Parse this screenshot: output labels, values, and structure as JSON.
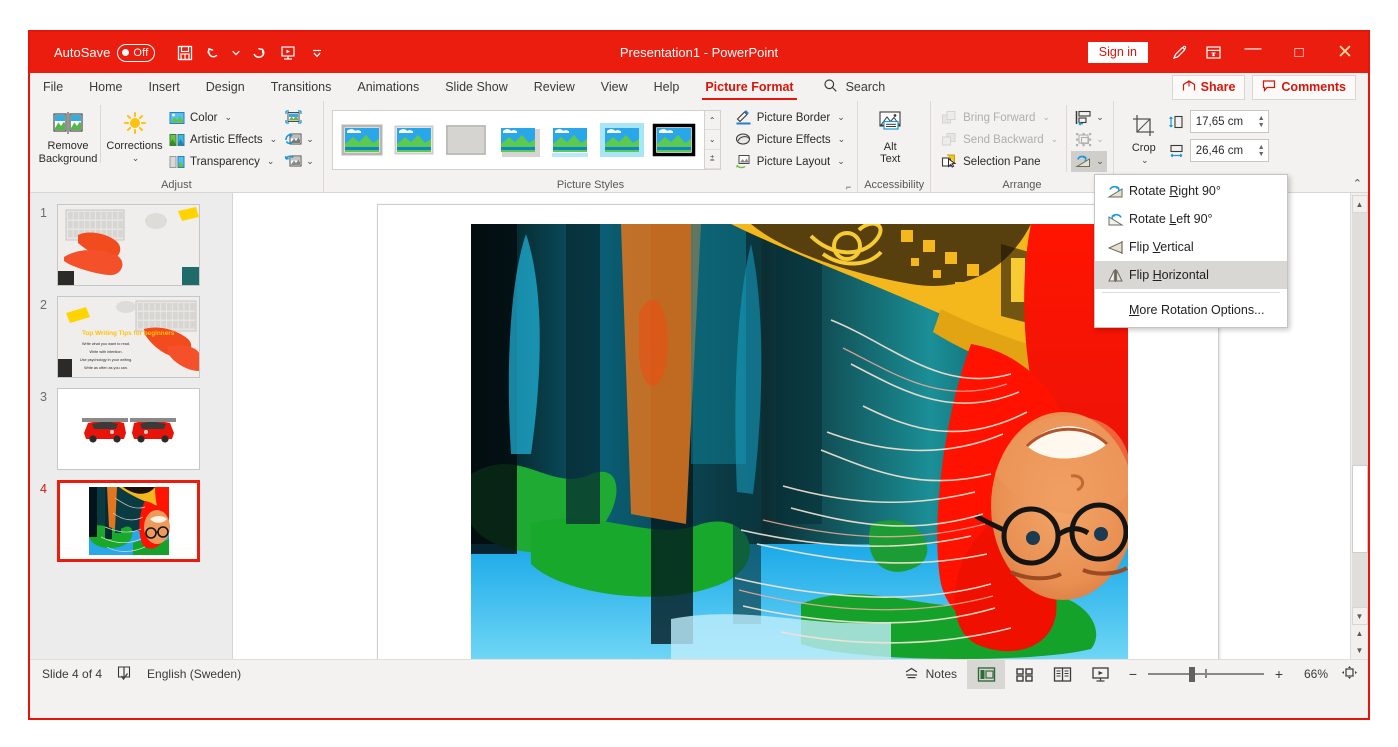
{
  "titlebar": {
    "autosave_label": "AutoSave",
    "autosave_state": "Off",
    "document_title": "Presentation1  -  PowerPoint",
    "signin_label": "Sign in",
    "qat": [
      {
        "name": "save-icon",
        "label": "Save"
      },
      {
        "name": "undo-icon",
        "label": "Undo"
      },
      {
        "name": "redo-icon",
        "label": "Redo"
      },
      {
        "name": "start-presentation-icon",
        "label": "Start From Beginning"
      },
      {
        "name": "customize-qat-icon",
        "label": "Customize Quick Access Toolbar"
      }
    ],
    "window_buttons": {
      "minimize": "—",
      "maximize": "□",
      "close": "✕"
    },
    "pen_icon": "draw-pen-icon",
    "ribbon_display_icon": "ribbon-display-options-icon"
  },
  "tabs": [
    {
      "label": "File",
      "active": false
    },
    {
      "label": "Home",
      "active": false
    },
    {
      "label": "Insert",
      "active": false
    },
    {
      "label": "Design",
      "active": false
    },
    {
      "label": "Transitions",
      "active": false
    },
    {
      "label": "Animations",
      "active": false
    },
    {
      "label": "Slide Show",
      "active": false
    },
    {
      "label": "Review",
      "active": false
    },
    {
      "label": "View",
      "active": false
    },
    {
      "label": "Help",
      "active": false
    },
    {
      "label": "Picture Format",
      "active": true
    }
  ],
  "search": {
    "label": "Search",
    "icon": "search-icon"
  },
  "tabstrip_right": {
    "share_label": "Share",
    "comments_label": "Comments"
  },
  "ribbon": {
    "groups": [
      {
        "name": "adjust",
        "label": "Adjust",
        "remove_background": "Remove\nBackground",
        "remove_background_line1": "Remove",
        "remove_background_line2": "Background",
        "corrections": "Corrections",
        "items": [
          {
            "label": "Color",
            "caret": true,
            "icon": "color-picture-icon"
          },
          {
            "label": "Artistic Effects",
            "caret": true,
            "icon": "artistic-effects-icon"
          },
          {
            "label": "Transparency",
            "caret": true,
            "icon": "transparency-icon"
          }
        ],
        "icon_only": [
          {
            "icon": "compress-pictures-icon",
            "caret": false
          },
          {
            "icon": "change-picture-icon",
            "caret": true
          },
          {
            "icon": "reset-picture-icon",
            "caret": true
          }
        ]
      },
      {
        "name": "picture-styles",
        "label": "Picture Styles",
        "style_count": 7,
        "selected_style_index": 6,
        "scroll_up": "⌃",
        "scroll_down": "⌄",
        "more": "⩲"
      },
      {
        "name": "picture-styles-right",
        "items": [
          {
            "label": "Picture Border",
            "caret": true,
            "icon": "picture-border-icon"
          },
          {
            "label": "Picture Effects",
            "caret": true,
            "icon": "picture-effects-icon"
          },
          {
            "label": "Picture Layout",
            "caret": true,
            "icon": "picture-layout-icon"
          }
        ]
      },
      {
        "name": "accessibility",
        "label": "Accessibility",
        "alt_text_line1": "Alt",
        "alt_text_line2": "Text"
      },
      {
        "name": "arrange",
        "label": "Arrange",
        "items": [
          {
            "label": "Bring Forward",
            "caret": true,
            "disabled": true,
            "icon": "bring-forward-icon"
          },
          {
            "label": "Send Backward",
            "caret": true,
            "disabled": true,
            "icon": "send-backward-icon"
          },
          {
            "label": "Selection Pane",
            "caret": false,
            "disabled": false,
            "icon": "selection-pane-icon"
          }
        ],
        "icon_only": [
          {
            "icon": "align-objects-icon",
            "caret": true,
            "disabled": false
          },
          {
            "icon": "group-objects-icon",
            "caret": true,
            "disabled": true
          },
          {
            "icon": "rotate-objects-icon",
            "caret": true,
            "disabled": false,
            "active": true
          }
        ]
      },
      {
        "name": "size",
        "label": "",
        "crop_label": "Crop",
        "height_value": "17,65 cm",
        "width_value": "26,46 cm",
        "height_icon": "shape-height-icon",
        "width_icon": "shape-width-icon"
      }
    ],
    "collapse_icon": "collapse-ribbon-icon"
  },
  "rotate_menu": {
    "items": [
      {
        "id": "rotate-right-90",
        "pre": "Rotate ",
        "accel": "R",
        "post": "ight 90°",
        "icon": "rotate-right-icon",
        "selected": false
      },
      {
        "id": "rotate-left-90",
        "pre": "Rotate ",
        "accel": "L",
        "post": "eft 90°",
        "icon": "rotate-left-icon",
        "selected": false
      },
      {
        "id": "flip-vertical",
        "pre": "Flip ",
        "accel": "V",
        "post": "ertical",
        "icon": "flip-vertical-icon",
        "selected": false
      },
      {
        "id": "flip-horizontal",
        "pre": "Flip ",
        "accel": "H",
        "post": "orizontal",
        "icon": "flip-horizontal-icon",
        "selected": true
      }
    ],
    "more_options": {
      "id": "more-rotation-options",
      "pre": "",
      "accel": "M",
      "post": "ore Rotation Options..."
    }
  },
  "thumbnails": [
    {
      "number": "1",
      "selected": false,
      "kind": "keyboard-hands"
    },
    {
      "number": "2",
      "selected": false,
      "kind": "keyboard-hands-text"
    },
    {
      "number": "3",
      "selected": false,
      "kind": "red-cars"
    },
    {
      "number": "4",
      "selected": true,
      "kind": "portrait-flipped"
    }
  ],
  "slide": {
    "picture_alt": "Upside-down portrait of a woman with glasses, vivid saturated colors",
    "selected": true
  },
  "statusbar": {
    "slide_counter": "Slide 4 of 4",
    "spellcheck_icon": "spellcheck-icon",
    "language": "English (Sweden)",
    "notes_label": "Notes",
    "notes_icon": "notes-icon",
    "views": [
      {
        "name": "normal-view",
        "icon": "normal-view-icon",
        "active": true
      },
      {
        "name": "slide-sorter-view",
        "icon": "slide-sorter-icon",
        "active": false
      },
      {
        "name": "reading-view",
        "icon": "reading-view-icon",
        "active": false
      },
      {
        "name": "slide-show-view",
        "icon": "slide-show-icon",
        "active": false
      }
    ],
    "zoom_out": "−",
    "zoom_in": "+",
    "zoom_percent": "66%",
    "fit_icon": "fit-slide-to-window-icon"
  },
  "colors": {
    "accent_red": "#eb1d0e",
    "ribbon_bg": "#f3f2f0",
    "selection_red": "#ec1c0d",
    "menu_highlight": "#d8d7d4"
  }
}
